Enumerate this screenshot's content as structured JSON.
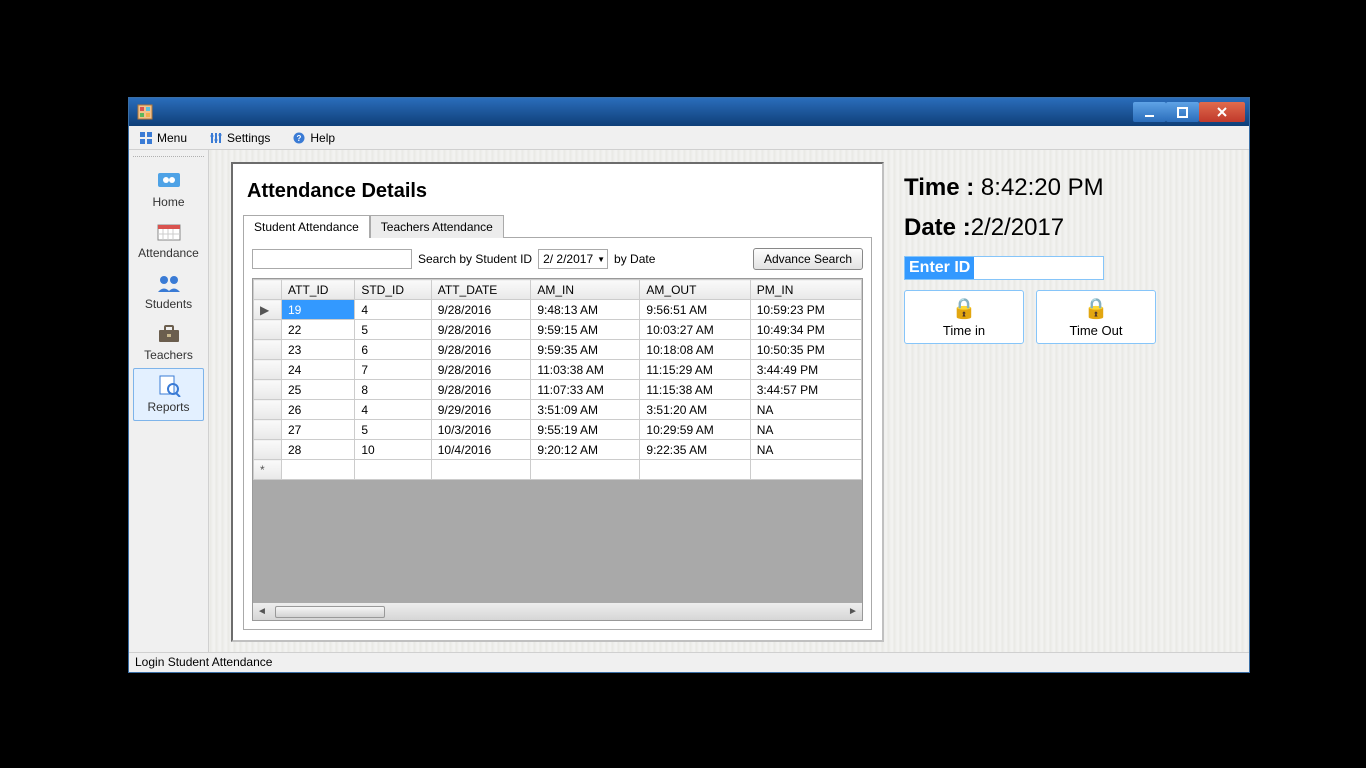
{
  "menubar": {
    "menu": "Menu",
    "settings": "Settings",
    "help": "Help"
  },
  "sidebar": {
    "home": "Home",
    "attendance": "Attendance",
    "students": "Students",
    "teachers": "Teachers",
    "reports": "Reports"
  },
  "panel": {
    "title": "Attendance Details",
    "tabs": {
      "student": "Student Attendance",
      "teachers": "Teachers Attendance"
    },
    "search": {
      "by_id_label": "Search by Student ID",
      "date_value": "2/ 2/2017",
      "by_date_label": "by Date",
      "advance_btn": "Advance Search"
    },
    "grid": {
      "cols": [
        "ATT_ID",
        "STD_ID",
        "ATT_DATE",
        "AM_IN",
        "AM_OUT",
        "PM_IN"
      ],
      "rows": [
        [
          "19",
          "4",
          "9/28/2016",
          "9:48:13 AM",
          "9:56:51 AM",
          "10:59:23 PM"
        ],
        [
          "22",
          "5",
          "9/28/2016",
          "9:59:15 AM",
          "10:03:27 AM",
          "10:49:34 PM"
        ],
        [
          "23",
          "6",
          "9/28/2016",
          "9:59:35 AM",
          "10:18:08 AM",
          "10:50:35 PM"
        ],
        [
          "24",
          "7",
          "9/28/2016",
          "11:03:38 AM",
          "11:15:29 AM",
          "3:44:49 PM"
        ],
        [
          "25",
          "8",
          "9/28/2016",
          "11:07:33 AM",
          "11:15:38 AM",
          "3:44:57 PM"
        ],
        [
          "26",
          "4",
          "9/29/2016",
          "3:51:09 AM",
          "3:51:20 AM",
          "NA"
        ],
        [
          "27",
          "5",
          "10/3/2016",
          "9:55:19 AM",
          "10:29:59 AM",
          "NA"
        ],
        [
          "28",
          "10",
          "10/4/2016",
          "9:20:12 AM",
          "9:22:35 AM",
          "NA"
        ]
      ],
      "row_indicator": "▶",
      "new_row_indicator": "*"
    }
  },
  "right": {
    "time_label": "Time : ",
    "time_value": "8:42:20 PM",
    "date_label": "Date :",
    "date_value": "2/2/2017",
    "enter_id_placeholder": "Enter ID",
    "time_in_btn": "Time in",
    "time_out_btn": "Time Out"
  },
  "statusbar": "Login Student Attendance"
}
